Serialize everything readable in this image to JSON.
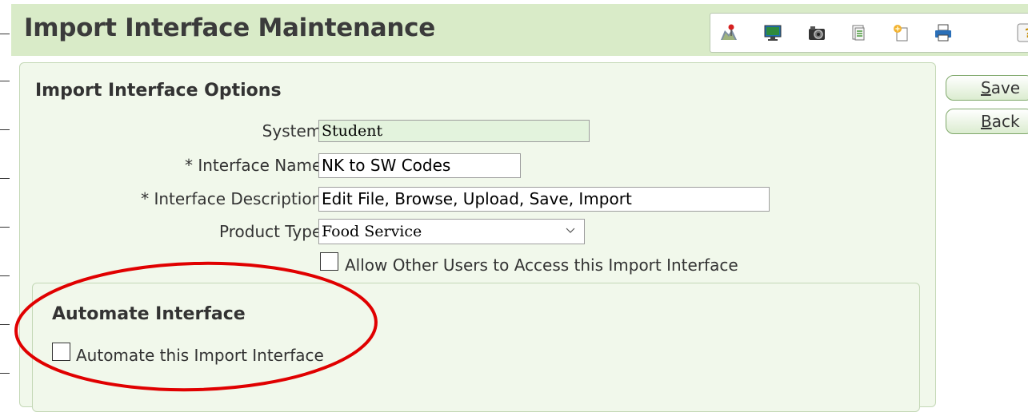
{
  "header": {
    "title": "Import Interface Maintenance",
    "toolbar_icons": [
      "map-pin-icon",
      "monitor-icon",
      "camera-icon",
      "document-icon",
      "new-document-icon",
      "print-icon",
      "help-icon"
    ]
  },
  "options": {
    "section_title": "Import Interface Options",
    "system": {
      "label": "System:",
      "value": "Student"
    },
    "interface_name": {
      "label": "* Interface Name:",
      "value": "NK to SW Codes"
    },
    "interface_description": {
      "label": "* Interface Description:",
      "value": "Edit File, Browse, Upload, Save, Import"
    },
    "product_type": {
      "label": "Product Type:",
      "value": "Food Service"
    },
    "allow_access": {
      "label": "Allow Other Users to Access this Import Interface",
      "checked": false
    }
  },
  "automate": {
    "section_title": "Automate Interface",
    "checkbox_label": "Automate this Import Interface",
    "checked": false
  },
  "sidebar": {
    "save_accel": "S",
    "save_rest": "ave",
    "back_accel": "B",
    "back_rest": "ack"
  },
  "colors": {
    "header_bg": "#d9ebc8",
    "panel_bg": "#f1f8eb",
    "readonly_field": "#e3f3dd",
    "highlight_ellipse": "#e00000"
  }
}
